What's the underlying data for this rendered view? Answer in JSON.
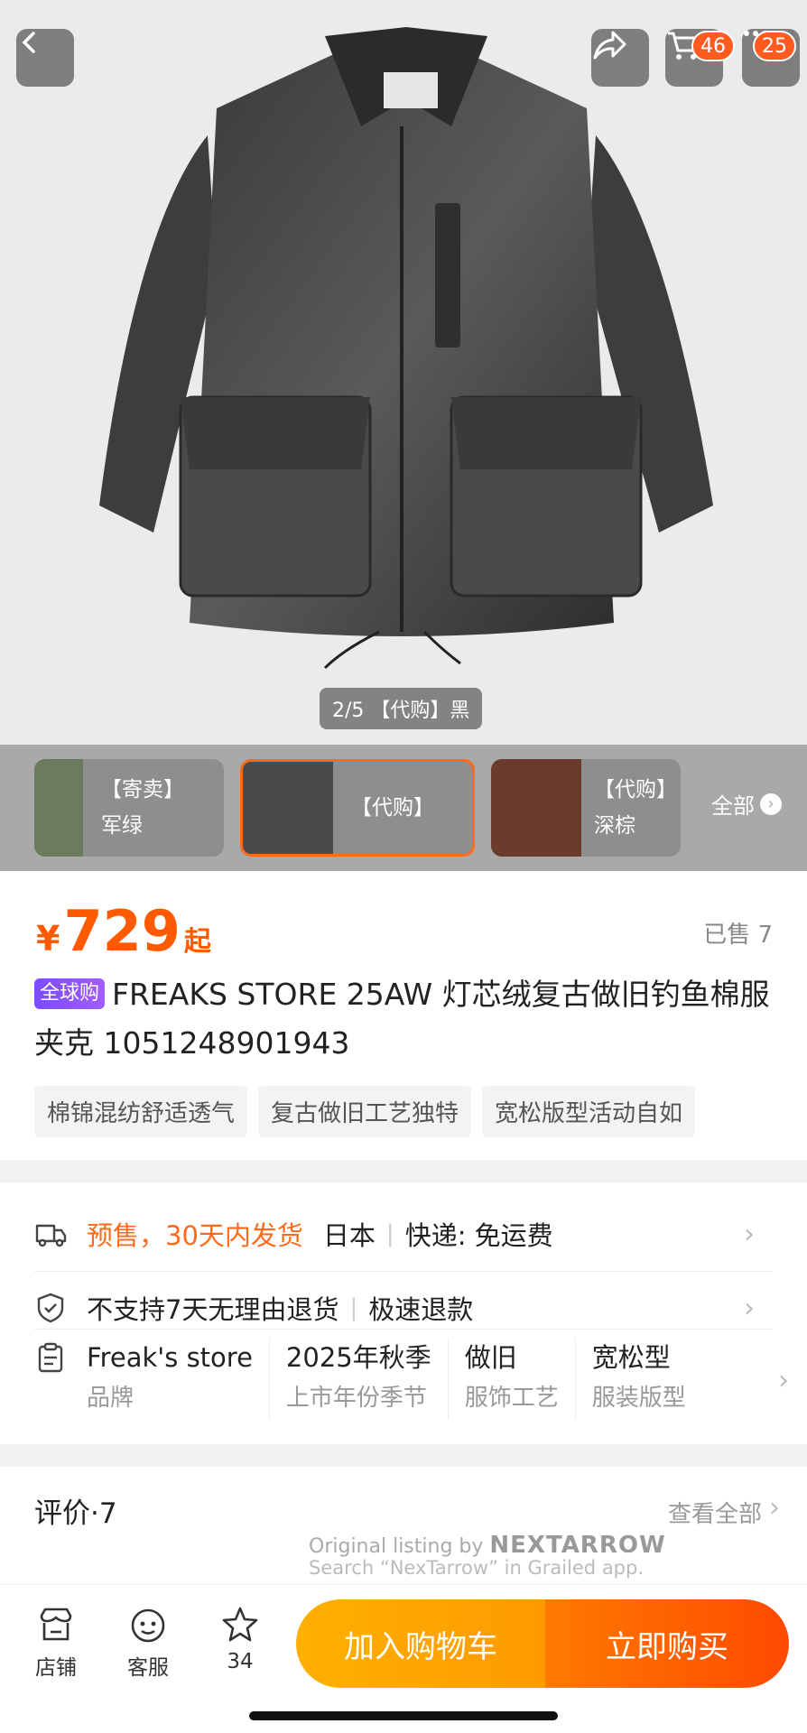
{
  "hero": {
    "indicator": "2/5 【代购】黑",
    "cart_badge": "46",
    "more_badge": "25"
  },
  "variants": {
    "items": [
      {
        "line1": "【寄卖】",
        "line2": "军绿"
      },
      {
        "line1": "【代购】",
        "line2": ""
      },
      {
        "line1": "【代购】",
        "line2": "深棕"
      }
    ],
    "all_label": "全部"
  },
  "product": {
    "currency": "¥",
    "price": "729",
    "price_suffix": "起",
    "sold": "已售 7",
    "global_tag": "全球购",
    "title": "FREAKS STORE 25AW 灯芯绒复古做旧钓鱼棉服夹克 1051248901943",
    "chips": [
      "棉锦混纺舒适透气",
      "复古做旧工艺独特",
      "宽松版型活动自如"
    ]
  },
  "service": {
    "shipping": {
      "presale": "预售，30天内发货",
      "origin": "日本",
      "express": "快递: 免运费"
    },
    "returns": {
      "policy": "不支持7天无理由退货",
      "refund": "极速退款"
    },
    "attrs": [
      {
        "value": "Freak's store",
        "key": "品牌"
      },
      {
        "value": "2025年秋季",
        "key": "上市年份季节"
      },
      {
        "value": "做旧",
        "key": "服饰工艺"
      },
      {
        "value": "宽松型",
        "key": "服装版型"
      }
    ]
  },
  "reviews": {
    "title": "评价·7",
    "view_all": "查看全部",
    "watermark_line1": "Original listing by",
    "watermark_brand": "NEXTARROW",
    "watermark_line2": "Search “NexTarrow” in Grailed app."
  },
  "bottom": {
    "store": "店铺",
    "service": "客服",
    "fav_count": "34",
    "add_cart": "加入购物车",
    "buy_now": "立即购买"
  },
  "colors": {
    "accent": "#ff5a00",
    "cart_btn": "#ffa500",
    "buy_btn": "#ff5a00",
    "global_tag": "#8a55ff"
  }
}
